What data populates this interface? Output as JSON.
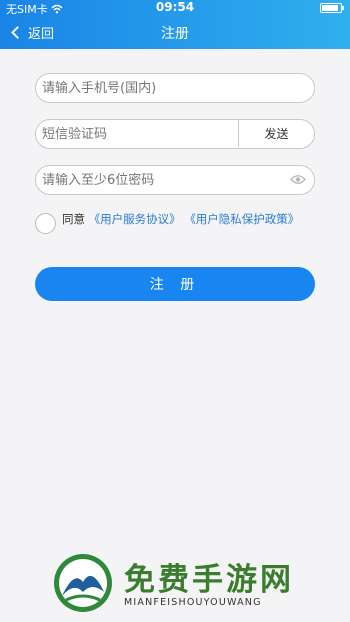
{
  "status_bar": {
    "carrier": "无SIM卡",
    "time": "09:54"
  },
  "nav": {
    "back_label": "返回",
    "title": "注册"
  },
  "form": {
    "phone_placeholder": "请输入手机号(国内)",
    "code_placeholder": "短信验证码",
    "send_label": "发送",
    "password_placeholder": "请输入至少6位密码"
  },
  "agreement": {
    "prefix": "同意",
    "user_agreement": "《用户服务协议》",
    "privacy_policy": "《用户隐私保护政策》"
  },
  "register_label": "注 册",
  "watermark": {
    "title": "免费手游网",
    "subtitle": "MIANFEISHOUYOUWANG"
  },
  "colors": {
    "header_start": "#1a84e6",
    "header_end": "#2fb0ee",
    "primary": "#1885f0",
    "link": "#2b7bd6"
  }
}
